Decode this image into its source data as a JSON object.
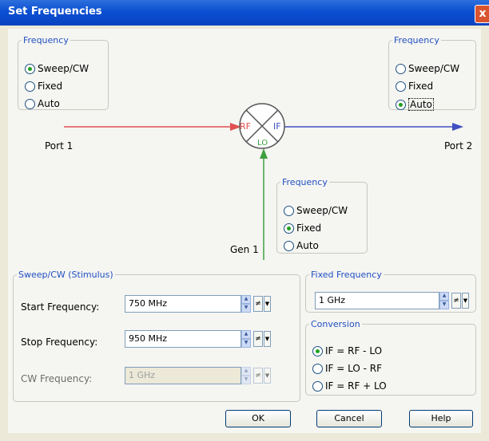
{
  "window": {
    "title": "Set Frequencies",
    "close_glyph": "x"
  },
  "colors": {
    "title_bar": "#0b4fd2",
    "legend_text": "#2050c0",
    "rf_arrow": "#e05050",
    "if_arrow": "#4050c0",
    "lo_arrow": "#40a040"
  },
  "freq_left": {
    "legend": "Frequency",
    "options": [
      "Sweep/CW",
      "Fixed",
      "Auto"
    ],
    "selected": "Sweep/CW"
  },
  "freq_right": {
    "legend": "Frequency",
    "options": [
      "Sweep/CW",
      "Fixed",
      "Auto"
    ],
    "selected": "Auto"
  },
  "freq_lo": {
    "legend": "Frequency",
    "options": [
      "Sweep/CW",
      "Fixed",
      "Auto"
    ],
    "selected": "Fixed"
  },
  "mixer": {
    "rf": "RF",
    "if": "IF",
    "lo": "LO"
  },
  "ports": {
    "port1": "Port 1",
    "port2": "Port 2",
    "gen1": "Gen 1"
  },
  "sweep": {
    "legend": "Sweep/CW (Stimulus)",
    "start_label": "Start Frequency:",
    "start_value": "750 MHz",
    "stop_label": "Stop Frequency:",
    "stop_value": "950 MHz",
    "cw_label": "CW Frequency:",
    "cw_value": "1 GHz",
    "f_glyph": "≠"
  },
  "fixed": {
    "legend": "Fixed Frequency",
    "value": "1 GHz"
  },
  "conversion": {
    "legend": "Conversion",
    "options": [
      "IF = RF - LO",
      "IF = LO - RF",
      "IF = RF + LO"
    ],
    "selected": "IF = RF - LO"
  },
  "buttons": {
    "ok": "OK",
    "cancel": "Cancel",
    "help": "Help"
  }
}
